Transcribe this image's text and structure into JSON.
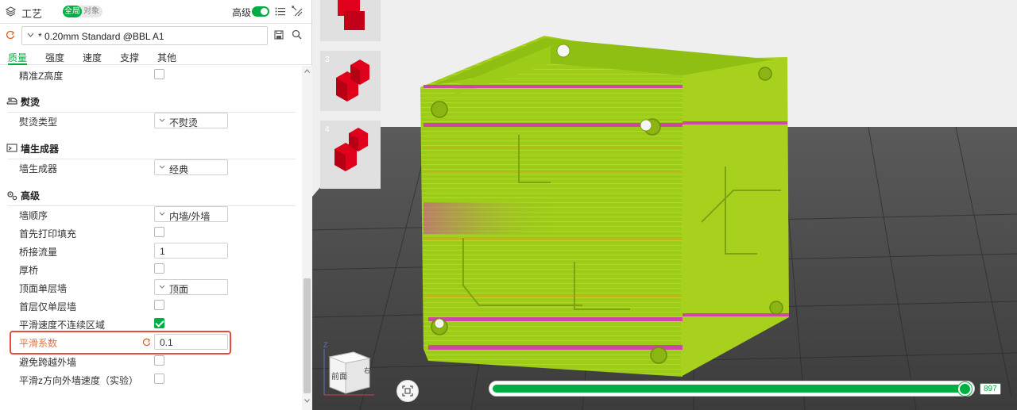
{
  "header": {
    "title": "工艺",
    "scope_global": "全局",
    "scope_object": "对象",
    "advanced_label": "高级",
    "advanced_on": true
  },
  "preset": {
    "value": "* 0.20mm Standard @BBL A1"
  },
  "tabs": [
    {
      "label": "质量",
      "active": true
    },
    {
      "label": "强度",
      "active": false
    },
    {
      "label": "速度",
      "active": false
    },
    {
      "label": "支撑",
      "active": false
    },
    {
      "label": "其他",
      "active": false
    }
  ],
  "settings": {
    "precise_z": {
      "label": "精准Z高度",
      "checked": false
    },
    "ironing": {
      "section": "熨烫",
      "type_label": "熨烫类型",
      "type_value": "不熨烫"
    },
    "wall_generator": {
      "section": "墙生成器",
      "label": "墙生成器",
      "value": "经典"
    },
    "advanced": {
      "section": "高级",
      "wall_order_label": "墙顺序",
      "wall_order_value": "内墙/外墙",
      "infill_first_label": "首先打印填充",
      "infill_first_checked": false,
      "bridge_flow_label": "桥接流量",
      "bridge_flow_value": "1",
      "thick_bridge_label": "厚桥",
      "thick_bridge_checked": false,
      "top_one_wall_label": "顶面单层墙",
      "top_one_wall_value": "顶面",
      "first_layer_one_wall_label": "首层仅单层墙",
      "first_layer_one_wall_checked": false,
      "smooth_speed_label": "平滑速度不连续区域",
      "smooth_speed_checked": true,
      "smooth_coef_label": "平滑系数",
      "smooth_coef_value": "0.1",
      "avoid_crossing_label": "避免跨越外墙",
      "avoid_crossing_checked": false,
      "smooth_z_label": "平滑z方向外墙速度（实验）",
      "smooth_z_checked": false
    }
  },
  "viewport": {
    "plates": [
      "3",
      "4"
    ],
    "navcube_front": "前面",
    "navcube_right": "右",
    "navcube_axis": "Z",
    "layer_value": "897",
    "layer_fraction": 1.0
  },
  "colors": {
    "accent": "#00ae42",
    "highlight_border": "#e84b3c",
    "model_green": "#9ccc18",
    "model_magenta": "#d62fbf",
    "thumb_red": "#e0001b"
  }
}
